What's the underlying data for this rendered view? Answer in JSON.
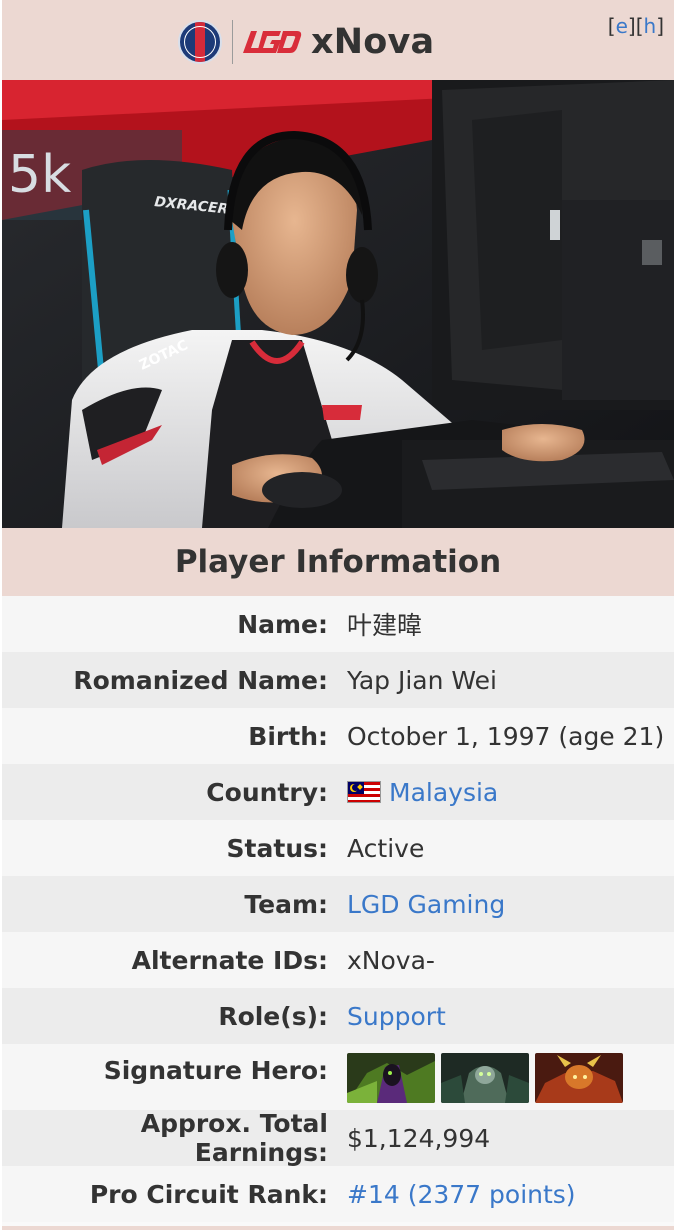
{
  "header": {
    "team_logo": "PSG.LGD",
    "player_name": "xNova",
    "edit_link": "e",
    "history_link": "h",
    "bracket_open": "[",
    "bracket_mid": "][",
    "bracket_close": "]"
  },
  "section_title": "Player Information",
  "info": [
    {
      "label": "Name:",
      "value": "叶建暐"
    },
    {
      "label": "Romanized Name:",
      "value": "Yap Jian Wei"
    },
    {
      "label": "Birth:",
      "value": "October 1, 1997 (age 21)"
    },
    {
      "label": "Country:",
      "value": "Malaysia",
      "flag": "malaysia-flag",
      "link": true
    },
    {
      "label": "Status:",
      "value": "Active"
    },
    {
      "label": "Team:",
      "value": "LGD Gaming",
      "link": true
    },
    {
      "label": "Alternate IDs:",
      "value": "xNova-"
    },
    {
      "label": "Role(s):",
      "value": "Support",
      "link": true
    },
    {
      "label": "Signature Hero:",
      "heroes": [
        "hero-portrait-1",
        "hero-portrait-2",
        "hero-portrait-3"
      ]
    },
    {
      "label": "Approx. Total Earnings:",
      "value": "$1,124,994"
    },
    {
      "label": "Pro Circuit Rank:",
      "value": "#14 (2377 points)",
      "link": true
    }
  ],
  "colors": {
    "header_bg": "#ecd8d2",
    "link": "#3a78c9",
    "text": "#333333",
    "row_odd": "#f6f6f6",
    "row_even": "#ececec"
  }
}
